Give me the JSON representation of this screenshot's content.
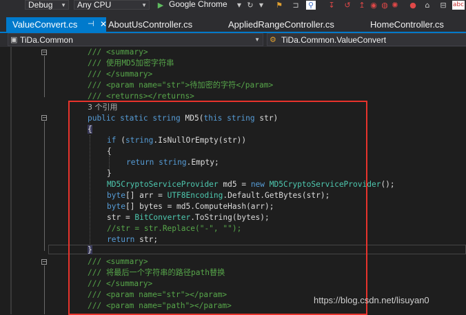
{
  "toolbar": {
    "config": "Debug",
    "platform": "Any CPU",
    "run_target": "Google Chrome",
    "extra_label": "abc"
  },
  "tabs": [
    {
      "label": "ValueConvert.cs",
      "active": true
    },
    {
      "label": "AboutUsController.cs",
      "active": false
    },
    {
      "label": "AppliedRangeController.cs",
      "active": false
    },
    {
      "label": "HomeController.cs",
      "active": false
    }
  ],
  "navbar": {
    "project": "TiDa.Common",
    "type": "TiDa.Common.ValueConvert"
  },
  "code": {
    "l1": "/// <summary>",
    "l2": "/// 使用MD5加密字符串",
    "l3": "/// </summary>",
    "l4a": "/// <param name=\"str\">",
    "l4b": "待加密的字符",
    "l4c": "</param>",
    "l5": "/// <returns></returns>",
    "refs": "3 个引用",
    "sig_public": "public",
    "sig_static": "static",
    "sig_string": "string",
    "sig_name": "MD5(",
    "sig_this": "this",
    "sig_string2": "string",
    "sig_param": "str)",
    "open_brace": "{",
    "if_kw": "if",
    "if_paren": "(",
    "if_type": "string",
    "if_rest": ".IsNullOrEmpty(str))",
    "inner_open": "{",
    "ret_kw": "return",
    "ret_type": "string",
    "ret_rest": ".Empty;",
    "inner_close": "}",
    "md5_type": "MD5CryptoServiceProvider",
    "md5_mid": " md5 = ",
    "md5_new": "new",
    "md5_type2": "MD5CryptoServiceProvider",
    "md5_end": "();",
    "arr_type": "byte",
    "arr_mid": "[] arr = ",
    "arr_type2": "UTF8Encoding",
    "arr_end": ".Default.GetBytes(str);",
    "bytes_type": "byte",
    "bytes_rest": "[] bytes = md5.ComputeHash(arr);",
    "str_start": "str = ",
    "str_type": "BitConverter",
    "str_end": ".ToString(bytes);",
    "comment_replace": "//str = str.Replace(\"-\", \"\");",
    "return_str_kw": "return",
    "return_str_rest": " str;",
    "close_brace": "}",
    "l2_1": "/// <summary>",
    "l2_2": "/// 将最后一个字符串的路径path替换",
    "l2_3": "/// </summary>",
    "l2_4a": "/// <param name=\"str\">",
    "l2_4b": "</param>",
    "l2_5a": "/// <param name=\"path\">",
    "l2_5b": "</param>"
  },
  "watermark": "https://blog.csdn.net/lisuyan0",
  "colors": {
    "accent": "#007acc",
    "highlight_box": "#e8332c",
    "comment": "#57a64a",
    "keyword": "#569cd6",
    "type": "#4ec9b0",
    "string": "#d69d85"
  }
}
